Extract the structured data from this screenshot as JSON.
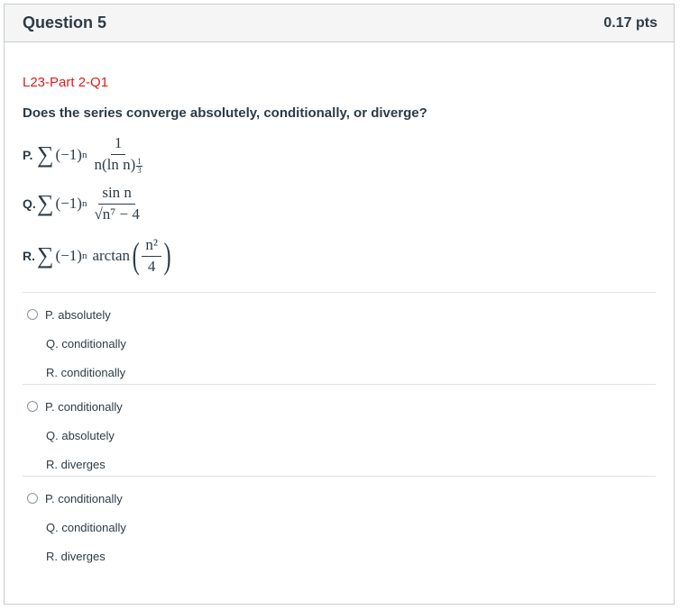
{
  "question": {
    "title": "Question 5",
    "points": "0.17 pts",
    "part_label": "L23-Part 2-Q1",
    "prompt": "Does the series converge absolutely, conditionally, or diverge?"
  },
  "series": [
    {
      "label": "P.",
      "sign": "(−1)",
      "exp": "n",
      "numerator": "1",
      "denominator": "n(ln n)",
      "den_exp_num": "1",
      "den_exp_den": "3"
    },
    {
      "label": "Q.",
      "sign": "(−1)",
      "exp": "n",
      "numerator": "sin n",
      "denominator": "√n⁷ − 4"
    },
    {
      "label": "R.",
      "sign": "(−1)",
      "exp": "n",
      "func": "arctan",
      "numerator": "n²",
      "denominator": "4"
    }
  ],
  "options": [
    {
      "lines": [
        "P. absolutely",
        "Q. conditionally",
        "R. conditionally"
      ]
    },
    {
      "lines": [
        "P. conditionally",
        "Q. absolutely",
        "R. diverges"
      ]
    },
    {
      "lines": [
        "P. conditionally",
        "Q. conditionally",
        "R. diverges"
      ]
    }
  ]
}
